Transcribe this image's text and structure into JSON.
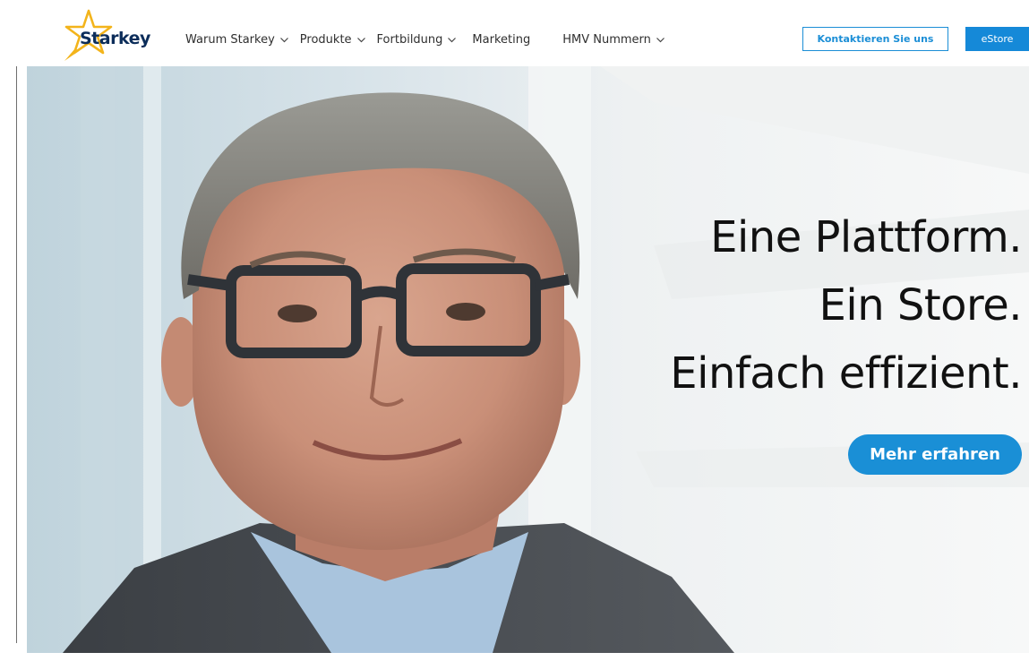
{
  "brand": {
    "name": "Starkey",
    "star_color": "#f3b41b",
    "text_color": "#0c2d5a"
  },
  "nav": {
    "items": [
      {
        "label": "Warum Starkey",
        "has_dropdown": true,
        "icon": "chevron-down-icon"
      },
      {
        "label": "Produkte",
        "has_dropdown": true,
        "icon": "chevron-down-icon"
      },
      {
        "label": "Fortbildung",
        "has_dropdown": true,
        "icon": "chevron-down-icon"
      },
      {
        "label": "Marketing",
        "has_dropdown": false
      },
      {
        "label": "HMV Nummern",
        "has_dropdown": true,
        "icon": "chevron-down-icon"
      }
    ]
  },
  "actions": {
    "contact_label": "Kontaktieren Sie uns",
    "estore_label": "eStore",
    "accent_color": "#1589d8"
  },
  "hero": {
    "headline": [
      "Eine Plattform.",
      "Ein Store.",
      "Einfach effizient."
    ],
    "cta_label": "Mehr erfahren",
    "image_subject": "portrait of smiling man with glasses"
  }
}
